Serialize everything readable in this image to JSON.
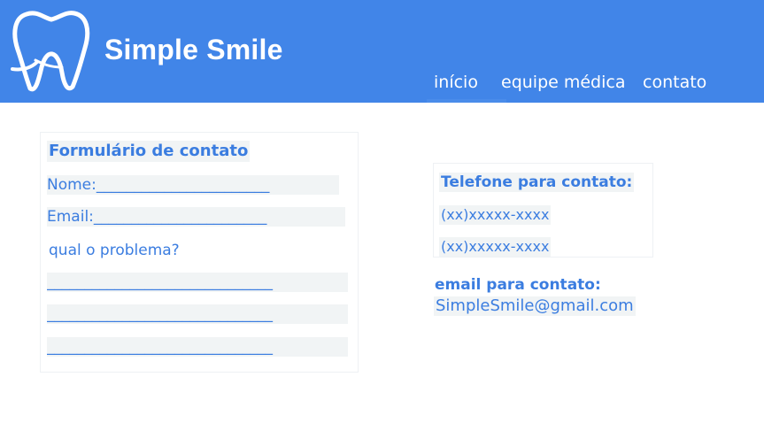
{
  "header": {
    "brand": "Simple Smile",
    "nav": [
      "início",
      "equipe médica",
      "contato"
    ]
  },
  "form": {
    "title": "Formulário de contato",
    "name_label": "Nome:_______________________",
    "email_label": "Email:_______________________",
    "problem_label": "qual o problema?",
    "lines": [
      "______________________________",
      "______________________________",
      "______________________________"
    ]
  },
  "contact": {
    "phone_title": "Telefone para contato:",
    "phones": [
      "(xx)xxxxx-xxxx",
      "(xx)xxxxx-xxxx"
    ],
    "email_title": "email para contato:",
    "email": "SimpleSmile@gmail.com"
  },
  "colors": {
    "header_bg": "#4185e8",
    "accent_text": "#3b7de0",
    "highlight_bg": "#f1f4f5"
  },
  "icons": {
    "logo": "tooth-icon"
  }
}
